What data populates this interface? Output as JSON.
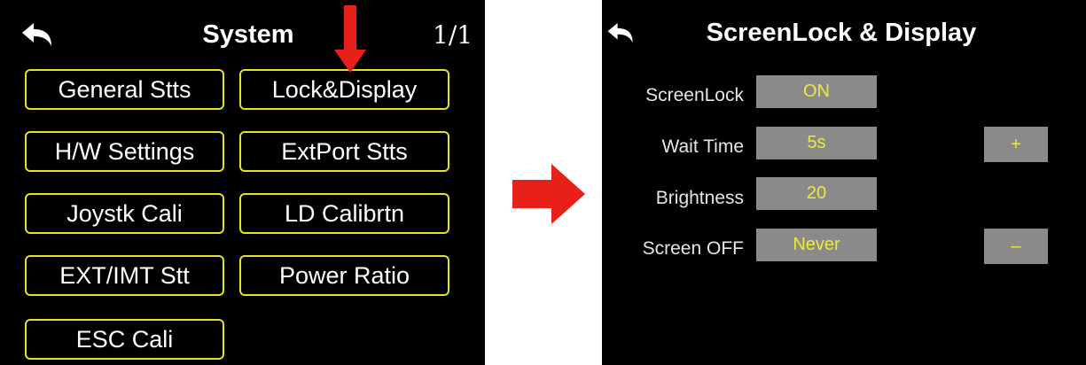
{
  "left_screen": {
    "title": "System",
    "page_indicator": "1/1",
    "back_icon": "back-arrow-icon",
    "menu": [
      {
        "label": "General Stts"
      },
      {
        "label": "Lock&Display"
      },
      {
        "label": "H/W Settings"
      },
      {
        "label": "ExtPort Stts"
      },
      {
        "label": "Joystk Cali"
      },
      {
        "label": "LD Calibrtn"
      },
      {
        "label": "EXT/IMT Stt"
      },
      {
        "label": "Power Ratio"
      },
      {
        "label": "ESC Cali"
      }
    ]
  },
  "annotation": {
    "arrow_color": "#e8201a",
    "down_arrow_icon": "red-down-arrow-icon",
    "right_arrow_icon": "red-right-arrow-icon"
  },
  "right_screen": {
    "title": "ScreenLock & Display",
    "back_icon": "back-arrow-icon",
    "settings": [
      {
        "label": "ScreenLock",
        "value": "ON"
      },
      {
        "label": "Wait Time",
        "value": "5s"
      },
      {
        "label": "Brightness",
        "value": "20"
      },
      {
        "label": "Screen OFF",
        "value": "Never"
      }
    ],
    "plus_label": "+",
    "minus_label": "–"
  },
  "colors": {
    "screen_background": "#000000",
    "button_border": "#e8e21a",
    "value_text": "#f0e83a",
    "value_box": "#8a8a8a"
  }
}
